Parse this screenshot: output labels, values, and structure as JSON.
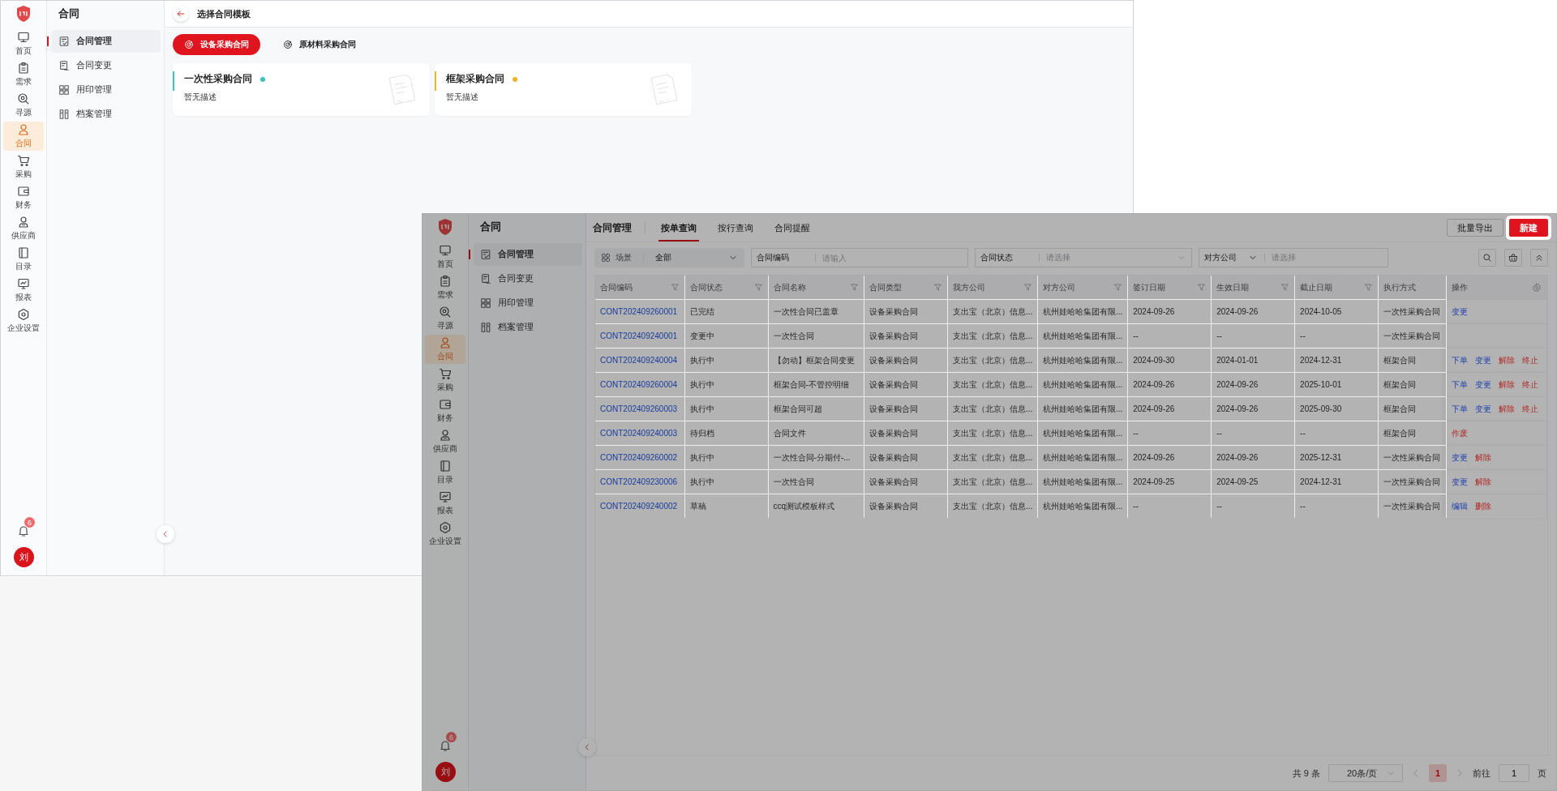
{
  "windows": [
    {
      "overlay": false,
      "rail": {
        "items": [
          {
            "label": "首页",
            "selected": false
          },
          {
            "label": "需求",
            "selected": false
          },
          {
            "label": "寻源",
            "selected": false
          },
          {
            "label": "合同",
            "selected": true
          },
          {
            "label": "采购",
            "selected": false
          },
          {
            "label": "财务",
            "selected": false
          },
          {
            "label": "供应商",
            "selected": false
          },
          {
            "label": "目录",
            "selected": false
          },
          {
            "label": "报表",
            "selected": false
          },
          {
            "label": "企业设置",
            "selected": false
          }
        ],
        "notification_count": "6",
        "avatar": "刘"
      },
      "subnav": {
        "title": "合同",
        "items": [
          {
            "label": "合同管理",
            "selected": true
          },
          {
            "label": "合同变更",
            "selected": false
          },
          {
            "label": "用印管理",
            "selected": false
          },
          {
            "label": "档案管理",
            "selected": false
          }
        ]
      },
      "page": {
        "kind": "template_picker",
        "title": "选择合同模板",
        "tabs": [
          {
            "label": "设备采购合同",
            "selected": true
          },
          {
            "label": "原材料采购合同",
            "selected": false
          }
        ],
        "templates": [
          {
            "name": "一次性采购合同",
            "description": "暂无描述",
            "color": "#3cc4c4"
          },
          {
            "name": "框架采购合同",
            "description": "暂无描述",
            "color": "#f5b125"
          }
        ]
      }
    },
    {
      "overlay": true,
      "rail": {
        "items": [
          {
            "label": "首页",
            "selected": false
          },
          {
            "label": "需求",
            "selected": false
          },
          {
            "label": "寻源",
            "selected": false
          },
          {
            "label": "合同",
            "selected": true
          },
          {
            "label": "采购",
            "selected": false
          },
          {
            "label": "财务",
            "selected": false
          },
          {
            "label": "供应商",
            "selected": false
          },
          {
            "label": "目录",
            "selected": false
          },
          {
            "label": "报表",
            "selected": false
          },
          {
            "label": "企业设置",
            "selected": false
          }
        ],
        "notification_count": "6",
        "avatar": "刘"
      },
      "subnav": {
        "title": "合同",
        "items": [
          {
            "label": "合同管理",
            "selected": true
          },
          {
            "label": "合同变更",
            "selected": false
          },
          {
            "label": "用印管理",
            "selected": false
          },
          {
            "label": "档案管理",
            "selected": false
          }
        ]
      },
      "page": {
        "kind": "contract_list",
        "title": "合同管理",
        "tabs": [
          {
            "label": "按单查询",
            "selected": true
          },
          {
            "label": "按行查询",
            "selected": false
          },
          {
            "label": "合同提醒",
            "selected": false
          }
        ],
        "actions": [
          {
            "label": "批量导出",
            "kind": "default",
            "spotlight": false
          },
          {
            "label": "新建",
            "kind": "primary",
            "spotlight": true
          }
        ],
        "filters": [
          {
            "kind": "scene",
            "label": "场景",
            "value": "全部"
          },
          {
            "kind": "input",
            "label": "合同编码",
            "placeholder": "请输入"
          },
          {
            "kind": "select",
            "label": "合同状态",
            "placeholder": "请选择"
          },
          {
            "kind": "label_select",
            "label": "对方公司",
            "placeholder": "请选择"
          }
        ],
        "table": {
          "columns": [
            {
              "label": "合同编码",
              "filterable": true,
              "kind": "link"
            },
            {
              "label": "合同状态",
              "filterable": true,
              "kind": "text"
            },
            {
              "label": "合同名称",
              "filterable": true,
              "kind": "text"
            },
            {
              "label": "合同类型",
              "filterable": true,
              "kind": "text"
            },
            {
              "label": "我方公司",
              "filterable": true,
              "kind": "text"
            },
            {
              "label": "对方公司",
              "filterable": true,
              "kind": "text"
            },
            {
              "label": "签订日期",
              "filterable": true,
              "kind": "text"
            },
            {
              "label": "生效日期",
              "filterable": true,
              "kind": "text"
            },
            {
              "label": "截止日期",
              "filterable": true,
              "kind": "text"
            },
            {
              "label": "执行方式",
              "filterable": false,
              "kind": "text"
            },
            {
              "label": "操作",
              "filterable": false,
              "kind": "actions"
            }
          ],
          "rows": [
            {
              "cells": [
                "CONT202409260001",
                "已完结",
                "一次性合同已盖章",
                "设备采购合同",
                "支出宝（北京）信息...",
                "杭州娃哈哈集团有限...",
                "2024-09-26",
                "2024-09-26",
                "2024-10-05",
                "一次性采购合同"
              ],
              "actions": [
                {
                  "label": "变更",
                  "kind": "normal"
                }
              ]
            },
            {
              "cells": [
                "CONT202409240001",
                "变更中",
                "一次性合同",
                "设备采购合同",
                "支出宝（北京）信息...",
                "杭州娃哈哈集团有限...",
                "--",
                "--",
                "--",
                "一次性采购合同"
              ]
            },
            {
              "cells": [
                "CONT202409240004",
                "执行中",
                "【勿动】框架合同变更",
                "设备采购合同",
                "支出宝（北京）信息...",
                "杭州娃哈哈集团有限...",
                "2024-09-30",
                "2024-01-01",
                "2024-12-31",
                "框架合同"
              ],
              "actions": [
                {
                  "label": "下单",
                  "kind": "normal"
                },
                {
                  "label": "变更",
                  "kind": "normal"
                },
                {
                  "label": "解除",
                  "kind": "danger"
                },
                {
                  "label": "终止",
                  "kind": "danger"
                }
              ]
            },
            {
              "cells": [
                "CONT202409260004",
                "执行中",
                "框架合同-不管控明细",
                "设备采购合同",
                "支出宝（北京）信息...",
                "杭州娃哈哈集团有限...",
                "2024-09-26",
                "2024-09-26",
                "2025-10-01",
                "框架合同"
              ],
              "actions": [
                {
                  "label": "下单",
                  "kind": "normal"
                },
                {
                  "label": "变更",
                  "kind": "normal"
                },
                {
                  "label": "解除",
                  "kind": "danger"
                },
                {
                  "label": "终止",
                  "kind": "danger"
                }
              ]
            },
            {
              "cells": [
                "CONT202409260003",
                "执行中",
                "框架合同可超",
                "设备采购合同",
                "支出宝（北京）信息...",
                "杭州娃哈哈集团有限...",
                "2024-09-26",
                "2024-09-26",
                "2025-09-30",
                "框架合同"
              ],
              "actions": [
                {
                  "label": "下单",
                  "kind": "normal"
                },
                {
                  "label": "变更",
                  "kind": "normal"
                },
                {
                  "label": "解除",
                  "kind": "danger"
                },
                {
                  "label": "终止",
                  "kind": "danger"
                }
              ]
            },
            {
              "cells": [
                "CONT202409240003",
                "待归档",
                "合同文件",
                "设备采购合同",
                "支出宝（北京）信息...",
                "杭州娃哈哈集团有限...",
                "--",
                "--",
                "--",
                "框架合同"
              ],
              "actions": [
                {
                  "label": "作废",
                  "kind": "danger"
                }
              ]
            },
            {
              "cells": [
                "CONT202409260002",
                "执行中",
                "一次性合同-分期付-...",
                "设备采购合同",
                "支出宝（北京）信息...",
                "杭州娃哈哈集团有限...",
                "2024-09-26",
                "2024-09-26",
                "2025-12-31",
                "一次性采购合同"
              ],
              "actions": [
                {
                  "label": "变更",
                  "kind": "normal"
                },
                {
                  "label": "解除",
                  "kind": "danger"
                }
              ]
            },
            {
              "cells": [
                "CONT202409230006",
                "执行中",
                "一次性合同",
                "设备采购合同",
                "支出宝（北京）信息...",
                "杭州娃哈哈集团有限...",
                "2024-09-25",
                "2024-09-25",
                "2024-12-31",
                "一次性采购合同"
              ],
              "actions": [
                {
                  "label": "变更",
                  "kind": "normal"
                },
                {
                  "label": "解除",
                  "kind": "danger"
                }
              ]
            },
            {
              "cells": [
                "CONT202409240002",
                "草稿",
                "ccq测试模板样式",
                "设备采购合同",
                "支出宝（北京）信息...",
                "杭州娃哈哈集团有限...",
                "--",
                "--",
                "--",
                "一次性采购合同"
              ],
              "actions": [
                {
                  "label": "编辑",
                  "kind": "normal"
                },
                {
                  "label": "删除",
                  "kind": "danger"
                }
              ]
            }
          ]
        },
        "pagination": {
          "total": "共 9 条",
          "page_size": "20条/页",
          "pages": [
            {
              "label": "1",
              "selected": true
            }
          ],
          "goto_label": "前往",
          "goto_value": "1",
          "goto_suffix": "页"
        }
      }
    }
  ]
}
